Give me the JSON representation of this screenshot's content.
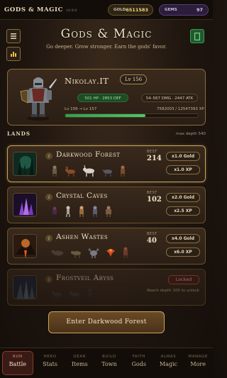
{
  "topbar": {
    "title": "GODS & MAGIC",
    "version": "v0.9.0",
    "gold_label": "GOLD",
    "gold_value": "6511583",
    "gems_label": "GEMS",
    "gems_value": "97"
  },
  "header": {
    "title": "Gods & Magic",
    "subtitle": "Go deeper. Grow stronger. Earn the gods' favor."
  },
  "character": {
    "name": "Nikolay.IT",
    "level_badge": "Lv 156",
    "hp_def": "501 HP · 2853 DEF",
    "dmg_atk": "54–567 DMG · 2447 ATK",
    "level_range": "Lv 156  →  Lv 157",
    "xp_text": "7582003 / 12547393 XP",
    "xp_progress": 0.604
  },
  "lands_section": {
    "label": "LANDS",
    "max_depth": "max depth 540"
  },
  "lands": [
    {
      "name": "Darkwood Forest",
      "best_label": "BEST",
      "best": "214",
      "gold_mult": "x1.0 Gold",
      "xp_mult": "x1.0 XP"
    },
    {
      "name": "Crystal Caves",
      "best_label": "BEST",
      "best": "102",
      "gold_mult": "x2.0 Gold",
      "xp_mult": "x2.5 XP"
    },
    {
      "name": "Ashen Wastes",
      "best_label": "BEST",
      "best": "40",
      "gold_mult": "x4.0 Gold",
      "xp_mult": "x6.0 XP"
    },
    {
      "name": "Frostveil Abyss",
      "locked_label": "Locked",
      "locked_hint": "Reach depth 100 to unlock"
    }
  ],
  "enter_button": "Enter Darkwood Forest",
  "tabs": [
    {
      "cat": "RUN",
      "name": "Battle"
    },
    {
      "cat": "HERO",
      "name": "Stats"
    },
    {
      "cat": "GEAR",
      "name": "Items"
    },
    {
      "cat": "BUILD",
      "name": "Town"
    },
    {
      "cat": "FAITH",
      "name": "Gods"
    },
    {
      "cat": "AURAS",
      "name": "Magic"
    },
    {
      "cat": "MANAGE",
      "name": "More"
    }
  ],
  "colors": {
    "accent_gold": "#c9a65a",
    "xp_green": "#4cc66a",
    "active_tab": "#8a3a2c"
  }
}
